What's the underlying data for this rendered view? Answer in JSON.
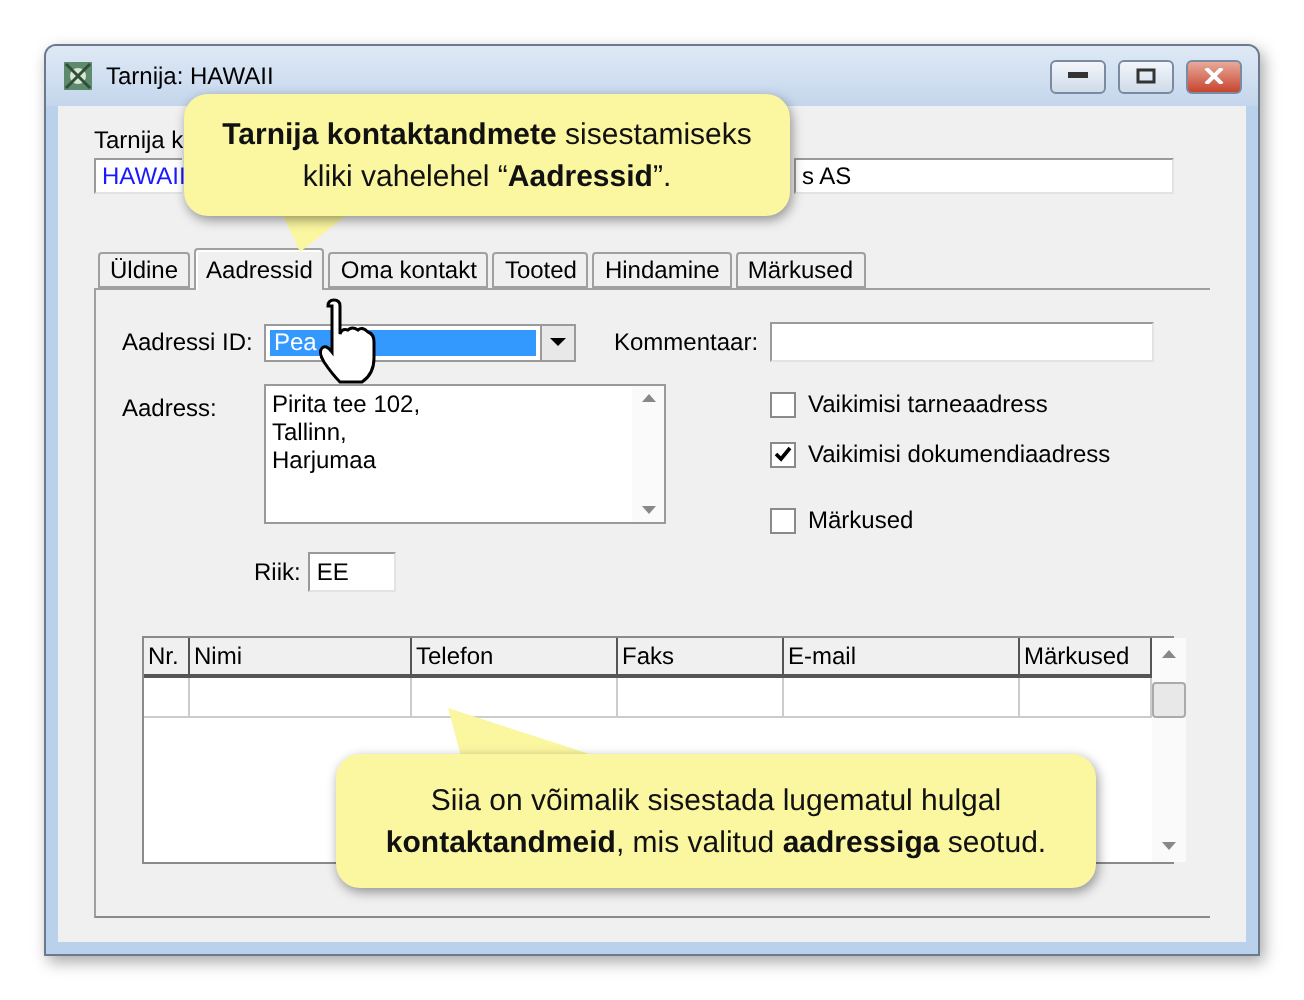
{
  "window": {
    "title": "Tarnija: HAWAII"
  },
  "header": {
    "code_label": "Tarnija k",
    "code_value": "HAWAII",
    "name_value": "s AS"
  },
  "tabs": [
    {
      "label": "Üldine",
      "selected": false
    },
    {
      "label": "Aadressid",
      "selected": true
    },
    {
      "label": "Oma kontakt",
      "selected": false
    },
    {
      "label": "Tooted",
      "selected": false
    },
    {
      "label": "Hindamine",
      "selected": false
    },
    {
      "label": "Märkused",
      "selected": false
    }
  ],
  "address": {
    "id_label": "Aadressi ID:",
    "id_value": "Pea",
    "id_highlighted": true,
    "comment_label": "Kommentaar:",
    "address_label": "Aadress:",
    "address_lines": [
      "Pirita tee 102,",
      "Tallinn,",
      "Harjumaa"
    ],
    "country_label": "Riik:",
    "country_value": "EE"
  },
  "checkboxes": [
    {
      "label": "Vaikimisi tarneaadress",
      "checked": false
    },
    {
      "label": "Vaikimisi dokumendiaadress",
      "checked": true
    },
    {
      "label": "Märkused",
      "checked": false
    }
  ],
  "table": {
    "columns": [
      "Nr.",
      "Nimi",
      "Telefon",
      "Faks",
      "E-mail",
      "Märkused"
    ]
  },
  "callouts": [
    {
      "text": "**Tarnija kontaktandmete** sisestamiseks kliki vahelehel “**Aadressid**”."
    },
    {
      "text": "Siia on võimalik sisestada lugematul hulgal **kontaktandmeid**, mis valitud **aadressiga** seotud."
    }
  ]
}
